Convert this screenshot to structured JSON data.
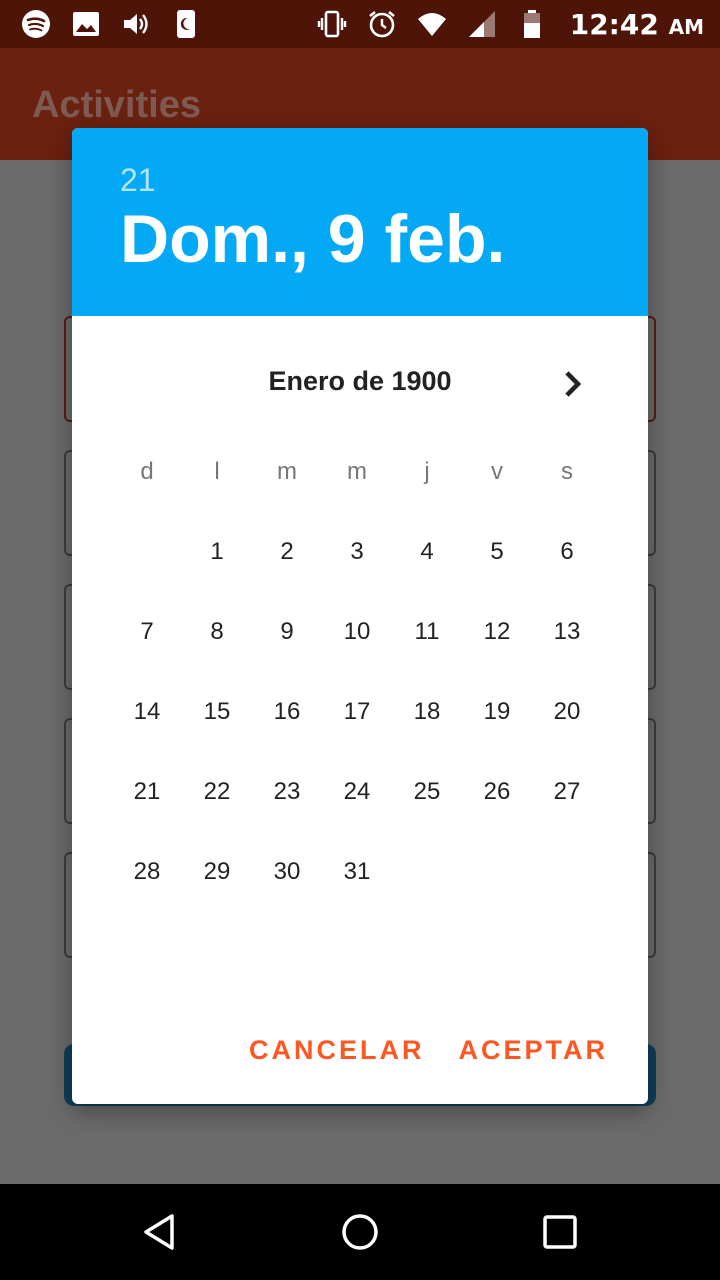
{
  "status_bar": {
    "left_icons": [
      "spotify-icon",
      "image-icon",
      "volume-icon",
      "sim-night-icon"
    ],
    "right_icons": [
      "vibrate-icon",
      "alarm-icon",
      "wifi-icon",
      "signal-icon",
      "battery-icon"
    ],
    "time": "12:42",
    "ampm": "AM"
  },
  "app_bar": {
    "title": "Activities"
  },
  "date_picker": {
    "header": {
      "year": "21",
      "date": "Dom., 9 feb."
    },
    "month_label": "Enero de 1900",
    "next_icon": "chevron-right-icon",
    "weekdays": [
      "d",
      "l",
      "m",
      "m",
      "j",
      "v",
      "s"
    ],
    "leading_blanks": 1,
    "days": [
      "1",
      "2",
      "3",
      "4",
      "5",
      "6",
      "7",
      "8",
      "9",
      "10",
      "11",
      "12",
      "13",
      "14",
      "15",
      "16",
      "17",
      "18",
      "19",
      "20",
      "21",
      "22",
      "23",
      "24",
      "25",
      "26",
      "27",
      "28",
      "29",
      "30",
      "31"
    ],
    "actions": {
      "cancel": "CANCELAR",
      "ok": "ACEPTAR"
    }
  },
  "nav_bar": {
    "icons": [
      "back-icon",
      "home-icon",
      "recents-icon"
    ]
  },
  "colors": {
    "header_bg": "#03a9f4",
    "accent": "#ff5722",
    "status_bar": "#4e1407",
    "app_bar": "#6a2110"
  }
}
